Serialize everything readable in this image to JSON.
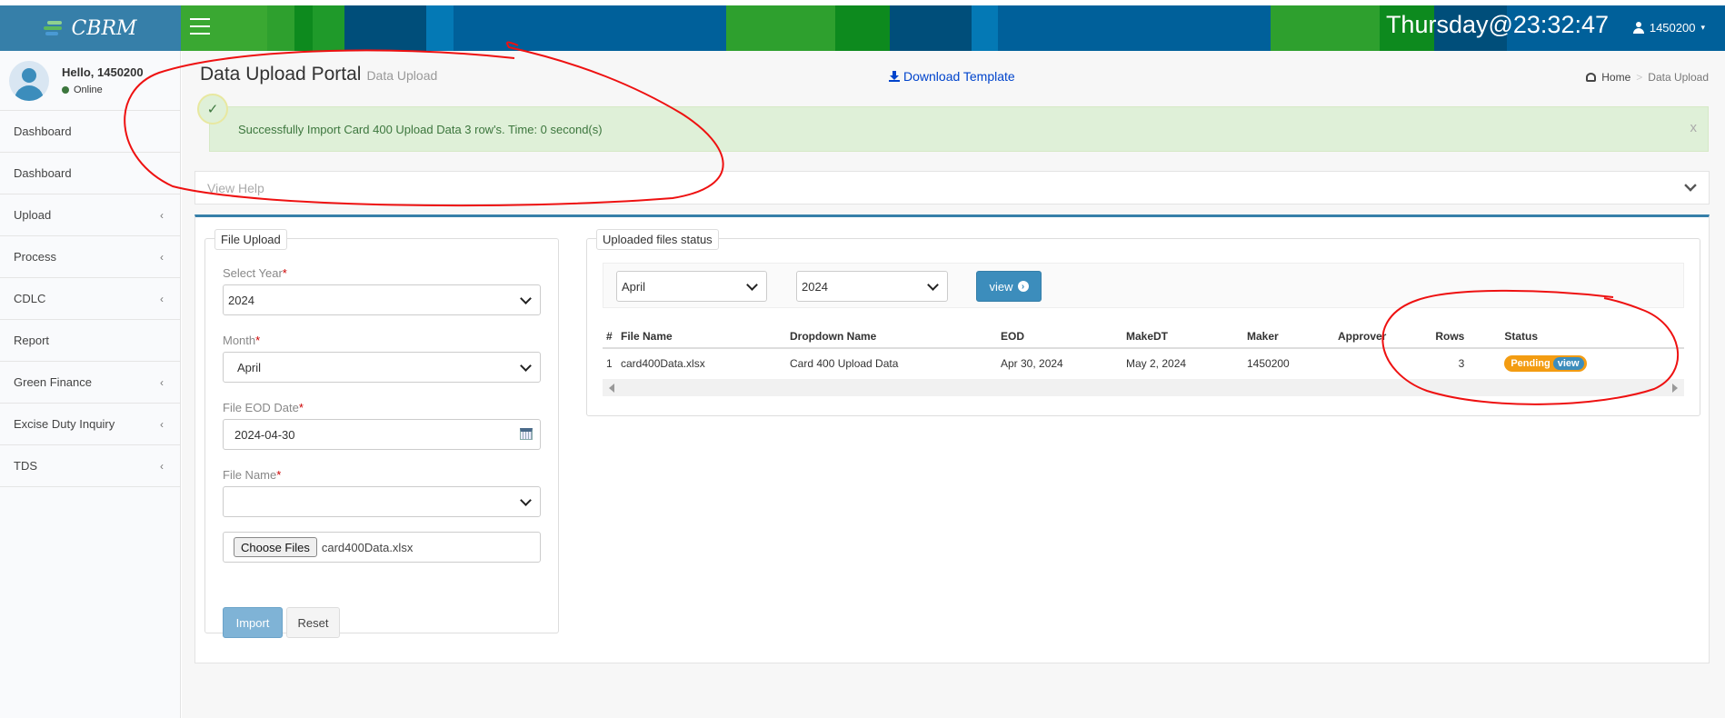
{
  "app": {
    "logo_text": "CBRM",
    "clock": "Thursday@23:32:47",
    "user_id": "1450200"
  },
  "colors": {
    "accent": "#3c8dbc",
    "header": "#367fa9",
    "success_bg": "#dff0d8",
    "success_text": "#3c763d",
    "pending": "#f39c12"
  },
  "sidebar": {
    "greeting": "Hello, 1450200",
    "status": "Online",
    "items": [
      {
        "label": "Dashboard",
        "has_children": false
      },
      {
        "label": "Dashboard",
        "has_children": false
      },
      {
        "label": "Upload",
        "has_children": true
      },
      {
        "label": "Process",
        "has_children": true
      },
      {
        "label": "CDLC",
        "has_children": true
      },
      {
        "label": "Report",
        "has_children": false
      },
      {
        "label": "Green Finance",
        "has_children": true
      },
      {
        "label": "Excise Duty Inquiry",
        "has_children": true
      },
      {
        "label": "TDS",
        "has_children": true
      }
    ]
  },
  "header": {
    "title": "Data Upload Portal",
    "subtitle": "Data Upload",
    "download_template": "Download Template",
    "breadcrumb": {
      "home": "Home",
      "current": "Data Upload"
    }
  },
  "alert": {
    "message": "Successfully Import Card 400 Upload Data 3 row's. Time: 0 second(s)",
    "close": "x"
  },
  "help": {
    "label": "View Help"
  },
  "file_upload": {
    "legend": "File Upload",
    "year_label": "Select Year",
    "year_value": "2024",
    "month_label": "Month",
    "month_value": "April",
    "eod_label": "File EOD Date",
    "eod_value": "2024-04-30",
    "file_name_label": "File Name",
    "file_name_value": "",
    "choose_files": "Choose Files",
    "chosen_file": "card400Data.xlsx",
    "import_button": "Import",
    "reset_button": "Reset"
  },
  "uploaded_status": {
    "legend": "Uploaded files status",
    "month_filter": "April",
    "year_filter": "2024",
    "view_button": "view",
    "columns": [
      "#",
      "File Name",
      "Dropdown Name",
      "EOD",
      "MakeDT",
      "Maker",
      "Approver",
      "Rows",
      "Status"
    ],
    "rows": [
      {
        "num": "1",
        "file_name": "card400Data.xlsx",
        "dropdown_name": "Card 400 Upload Data",
        "eod": "Apr 30, 2024",
        "makedt": "May 2, 2024",
        "maker": "1450200",
        "approver": "",
        "rows": "3",
        "status": "Pending",
        "status_action": "view"
      }
    ]
  }
}
